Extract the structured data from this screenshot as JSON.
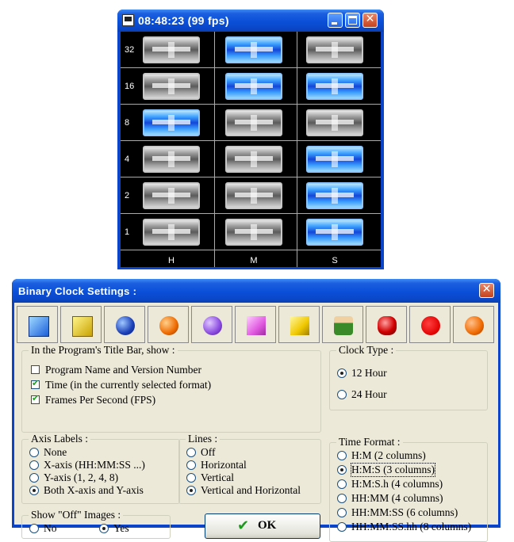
{
  "clock_window": {
    "title": "08:48:23 (99 fps)",
    "row_labels": [
      "32",
      "16",
      "8",
      "4",
      "2",
      "1"
    ],
    "column_labels": [
      "H",
      "M",
      "S"
    ],
    "bits": {
      "H": [
        false,
        false,
        true,
        false,
        false,
        false
      ],
      "M": [
        true,
        true,
        false,
        false,
        false,
        false
      ],
      "S": [
        false,
        true,
        false,
        true,
        true,
        true
      ]
    },
    "colors": {
      "on": "#2a7dff",
      "off": "#9a9a9a",
      "background": "#000000"
    }
  },
  "settings": {
    "title": "Binary Clock Settings :",
    "image_choices": [
      "blue-square-icon",
      "yellow-square-icon",
      "blue-sphere-icon",
      "orange-sphere-icon",
      "purple-sphere-icon",
      "pink-cube-icon",
      "yellow-cube-icon",
      "green-character-icon",
      "red-gem-icon",
      "red-circle-icon",
      "orange-circle-icon"
    ],
    "title_bar": {
      "legend": "In the Program's Title Bar, show :",
      "options": [
        {
          "label": "Program Name and Version Number",
          "checked": false
        },
        {
          "label": "Time (in the currently selected format)",
          "checked": true
        },
        {
          "label": "Frames Per Second (FPS)",
          "checked": true
        }
      ]
    },
    "clock_type": {
      "legend": "Clock Type :",
      "options": [
        {
          "label": "12 Hour",
          "selected": true
        },
        {
          "label": "24 Hour",
          "selected": false
        }
      ]
    },
    "axis_labels": {
      "legend": "Axis Labels :",
      "options": [
        {
          "label": "None",
          "selected": false
        },
        {
          "label": "X-axis (HH:MM:SS ...)",
          "selected": false
        },
        {
          "label": "Y-axis (1, 2, 4, 8)",
          "selected": false
        },
        {
          "label": "Both X-axis and Y-axis",
          "selected": true
        }
      ]
    },
    "lines": {
      "legend": "Lines :",
      "options": [
        {
          "label": "Off",
          "selected": false
        },
        {
          "label": "Horizontal",
          "selected": false
        },
        {
          "label": "Vertical",
          "selected": false
        },
        {
          "label": "Vertical and Horizontal",
          "selected": true
        }
      ]
    },
    "time_format": {
      "legend": "Time Format :",
      "options": [
        {
          "label": "H:M (2 columns)",
          "selected": false
        },
        {
          "label": "H:M:S (3 columns)",
          "selected": true
        },
        {
          "label": "H:M:S.h (4 columns)",
          "selected": false
        },
        {
          "label": "HH:MM (4 columns)",
          "selected": false
        },
        {
          "label": "HH:MM:SS (6 columns)",
          "selected": false
        },
        {
          "label": "HH:MM:SS.hh (8 columns)",
          "selected": false
        }
      ]
    },
    "show_off_images": {
      "legend": "Show \"Off\" Images :",
      "options": [
        {
          "label": "No",
          "selected": false
        },
        {
          "label": "Yes",
          "selected": true
        }
      ]
    },
    "ok_label": "OK"
  }
}
